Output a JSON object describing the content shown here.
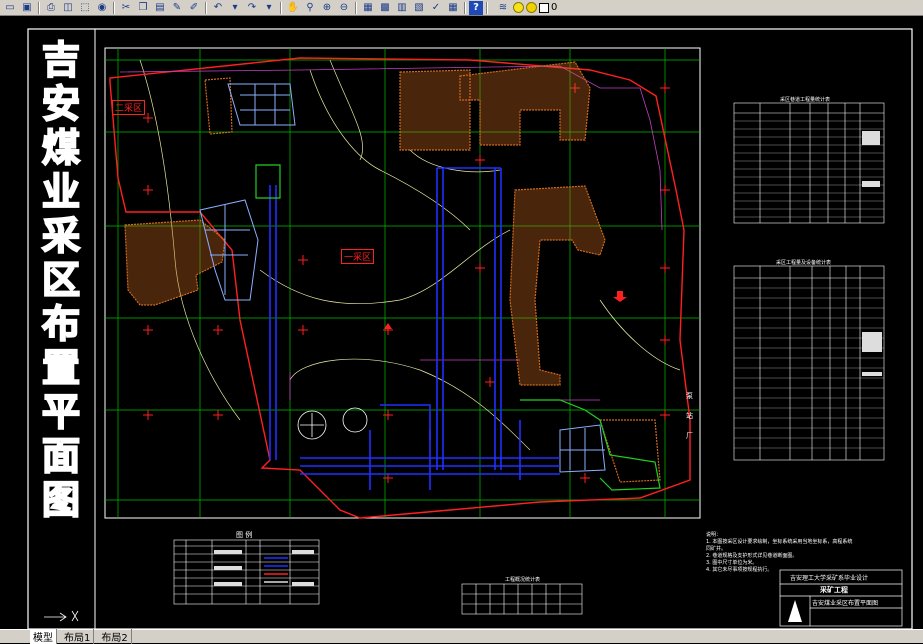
{
  "toolbar": {
    "help_label": "?",
    "layer_value": "0"
  },
  "drawing": {
    "vertical_title_chars": [
      "吉",
      "安",
      "煤",
      "业",
      "采",
      "区",
      "布",
      "置",
      "平",
      "面",
      "图"
    ],
    "region_one": "一采区",
    "region_two": "二采区",
    "river_chars": [
      "泵",
      "站",
      "厂"
    ],
    "legend_heading": "图  例",
    "bottom_table_title": "工程概况统计表",
    "right_table_1_title": "采区巷道工程量统计表",
    "right_table_2_title": "采区工程量及设备统计表",
    "notes_heading": "说明：",
    "notes": [
      "1. 本图按采区设计要求绘制，坐标系统采用当地坐标系，高程系统同矿井。",
      "2. 巷道规格及支护形式详见巷道断面图。",
      "3. 图中尺寸单位为米。",
      "4. 其它未尽事项按规程执行。"
    ],
    "title_block": {
      "school": "吉安理工大学采矿系毕业设计",
      "project": "采矿工程",
      "drawing_name": "吉安煤业采区布置平面图"
    }
  },
  "tabs": [
    "模型",
    "布局1",
    "布局2"
  ],
  "colors": {
    "background": "#000000",
    "boundary": "#ff2020",
    "grid": "#00c000",
    "roadway": "#2030ff",
    "goaf": "#d06a20",
    "contour": "#e8e8a0"
  }
}
